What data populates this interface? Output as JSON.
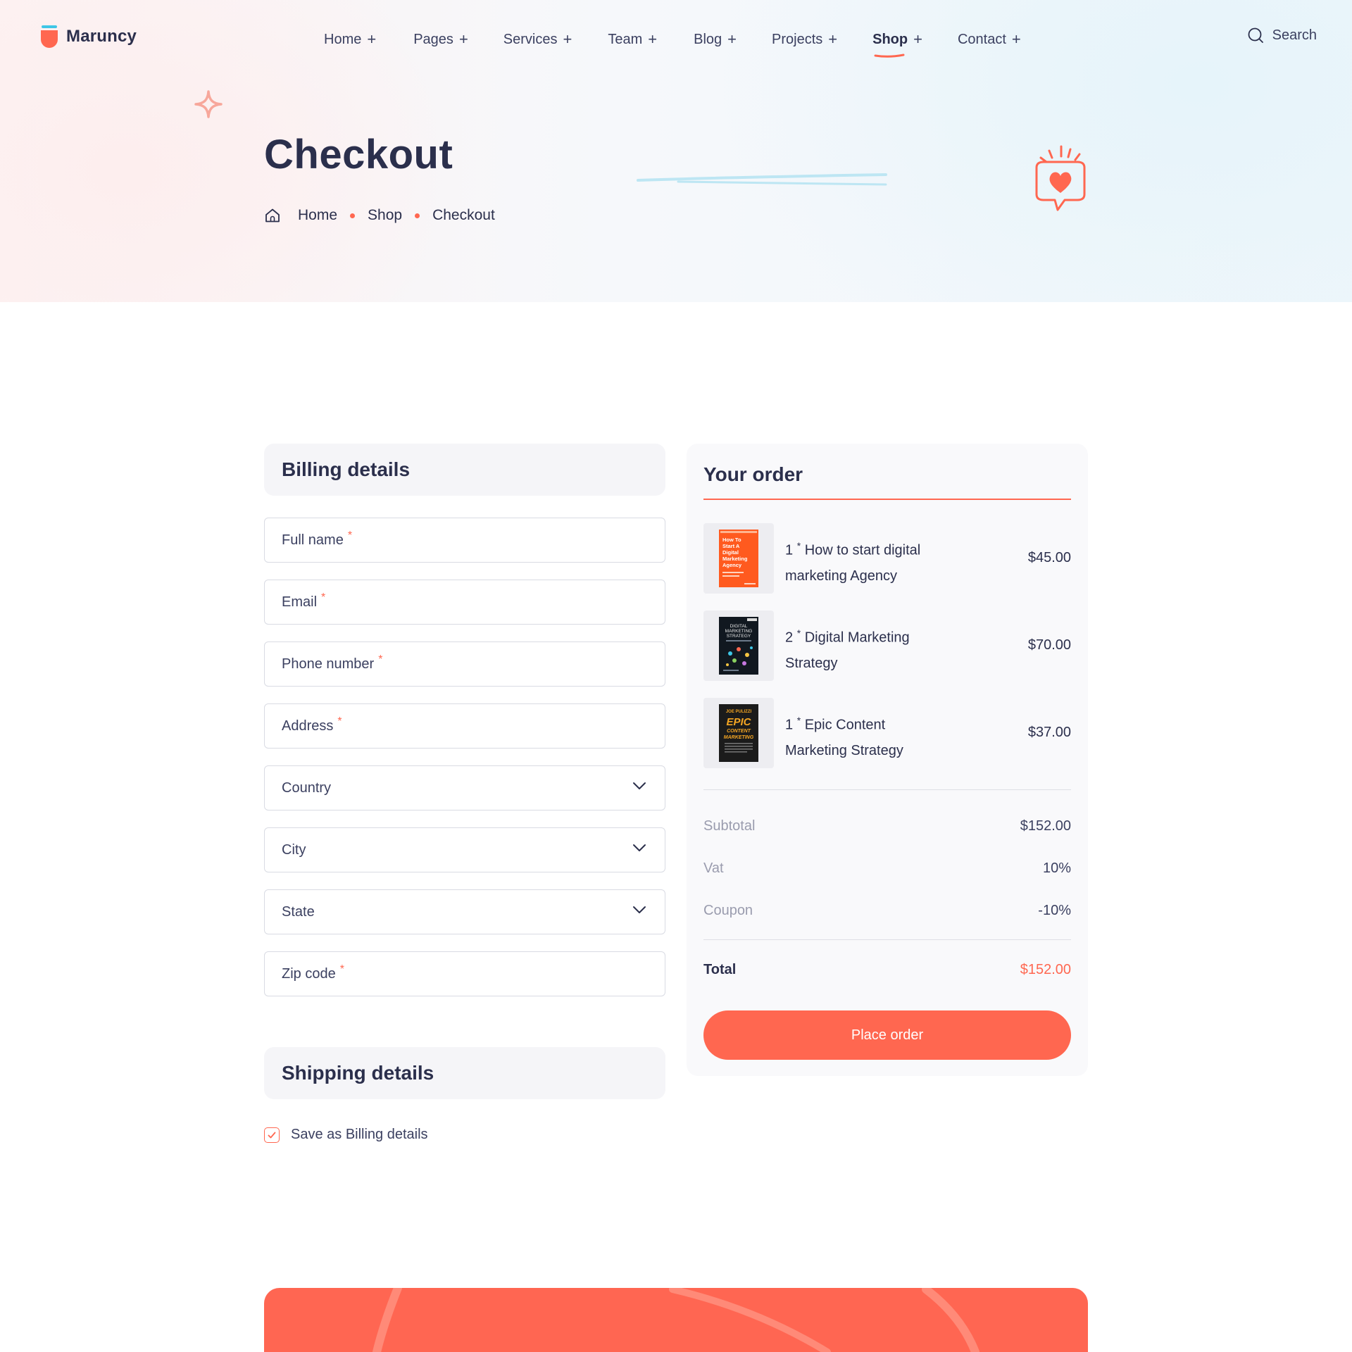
{
  "brand": {
    "name": "Maruncy",
    "accent": "#ff6750",
    "accent_blue": "#3ec6e6"
  },
  "nav": [
    {
      "label": "Home"
    },
    {
      "label": "Pages"
    },
    {
      "label": "Services"
    },
    {
      "label": "Team"
    },
    {
      "label": "Blog"
    },
    {
      "label": "Projects"
    },
    {
      "label": "Shop",
      "active": true
    },
    {
      "label": "Contact"
    }
  ],
  "nav_expand_symbol": "+",
  "search": {
    "label": "Search"
  },
  "hero": {
    "title": "Checkout",
    "breadcrumb": [
      "Home",
      "Shop",
      "Checkout"
    ]
  },
  "billing": {
    "heading": "Billing details",
    "fields": [
      {
        "placeholder": "Full name",
        "required": true,
        "type": "input"
      },
      {
        "placeholder": "Email",
        "required": true,
        "type": "input"
      },
      {
        "placeholder": "Phone number",
        "required": true,
        "type": "input"
      },
      {
        "placeholder": "Address",
        "required": true,
        "type": "input"
      },
      {
        "placeholder": "Country",
        "required": false,
        "type": "select"
      },
      {
        "placeholder": "City",
        "required": false,
        "type": "select"
      },
      {
        "placeholder": "State",
        "required": false,
        "type": "select"
      },
      {
        "placeholder": "Zip code",
        "required": true,
        "type": "input"
      }
    ],
    "required_mark": "*"
  },
  "shipping": {
    "heading": "Shipping details",
    "checkbox_label": "Save as Billing details",
    "checked": true
  },
  "order": {
    "heading": "Your order",
    "items": [
      {
        "qty": "1",
        "name_line1": "How to start digital",
        "name_line2": "marketing Agency",
        "price": "$45.00",
        "cover_title": "How To Start A Digital Marketing Agency"
      },
      {
        "qty": "2",
        "name_line1": "Digital Marketing",
        "name_line2": "Strategy",
        "price": "$70.00",
        "cover_title": "DIGITAL MARKETING STRATEGY"
      },
      {
        "qty": "1",
        "name_line1": "Epic Content",
        "name_line2": "Marketing Strategy",
        "price": "$37.00",
        "cover_title": "EPIC CONTENT MARKETING"
      }
    ],
    "qty_sep": "*",
    "summary": [
      {
        "label": "Subtotal",
        "value": "$152.00"
      },
      {
        "label": "Vat",
        "value": "10%"
      },
      {
        "label": "Coupon",
        "value": "-10%"
      }
    ],
    "total": {
      "label": "Total",
      "value": "$152.00"
    },
    "place_order_label": "Place order"
  }
}
